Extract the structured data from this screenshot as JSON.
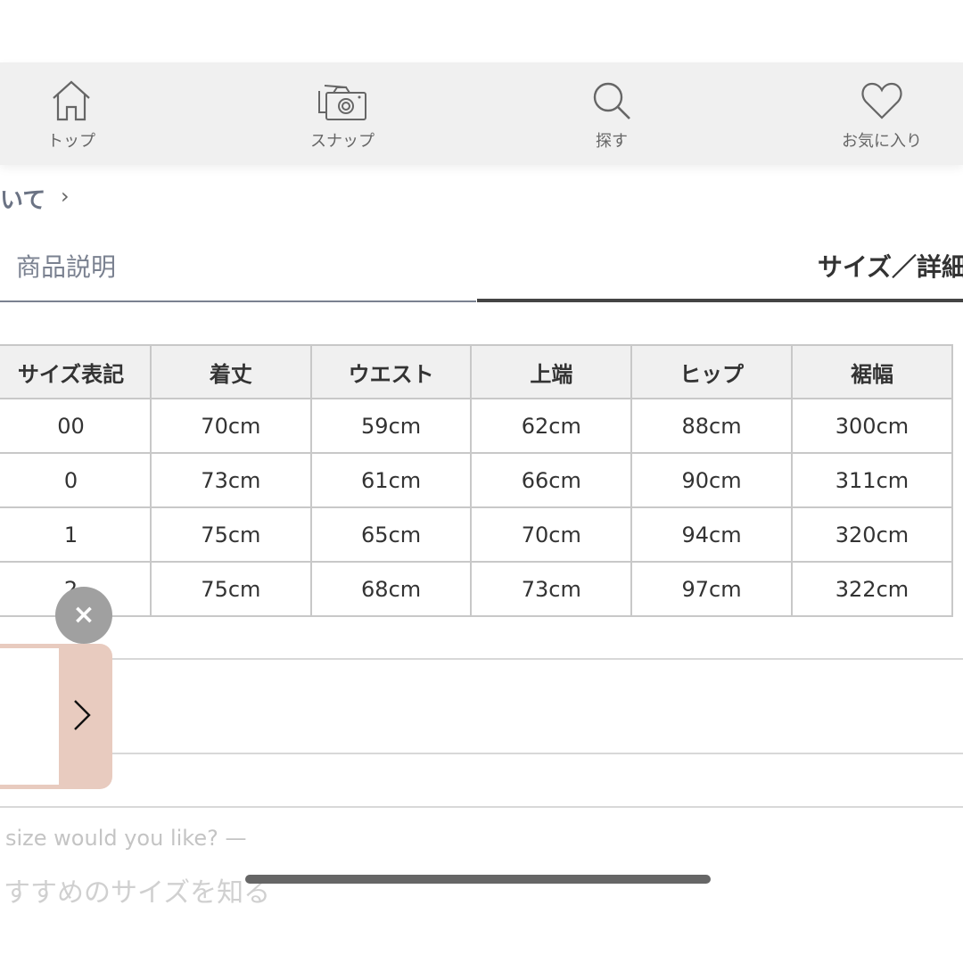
{
  "nav": {
    "items": [
      {
        "label": "トップ",
        "icon": "home-icon"
      },
      {
        "label": "スナップ",
        "icon": "camera-icon"
      },
      {
        "label": "探す",
        "icon": "search-icon"
      },
      {
        "label": "お気に入り",
        "icon": "heart-icon"
      }
    ]
  },
  "breadcrumb": {
    "text": "いて"
  },
  "tabs": [
    {
      "label": "商品説明",
      "active": false
    },
    {
      "label": "サイズ／詳細",
      "active": true
    }
  ],
  "size_table": {
    "headers": [
      "サイズ表記",
      "着丈",
      "ウエスト",
      "上端",
      "ヒップ",
      "裾幅"
    ],
    "rows": [
      [
        "00",
        "70cm",
        "59cm",
        "62cm",
        "88cm",
        "300cm"
      ],
      [
        "0",
        "73cm",
        "61cm",
        "66cm",
        "90cm",
        "311cm"
      ],
      [
        "1",
        "75cm",
        "65cm",
        "70cm",
        "94cm",
        "320cm"
      ],
      [
        "2",
        "75cm",
        "68cm",
        "73cm",
        "97cm",
        "322cm"
      ]
    ]
  },
  "popup": {
    "close_label": "×",
    "accent": "#e8cbbf"
  },
  "size_prompt": {
    "question": "size would you like? —",
    "cta": "すすめのサイズを知る"
  }
}
